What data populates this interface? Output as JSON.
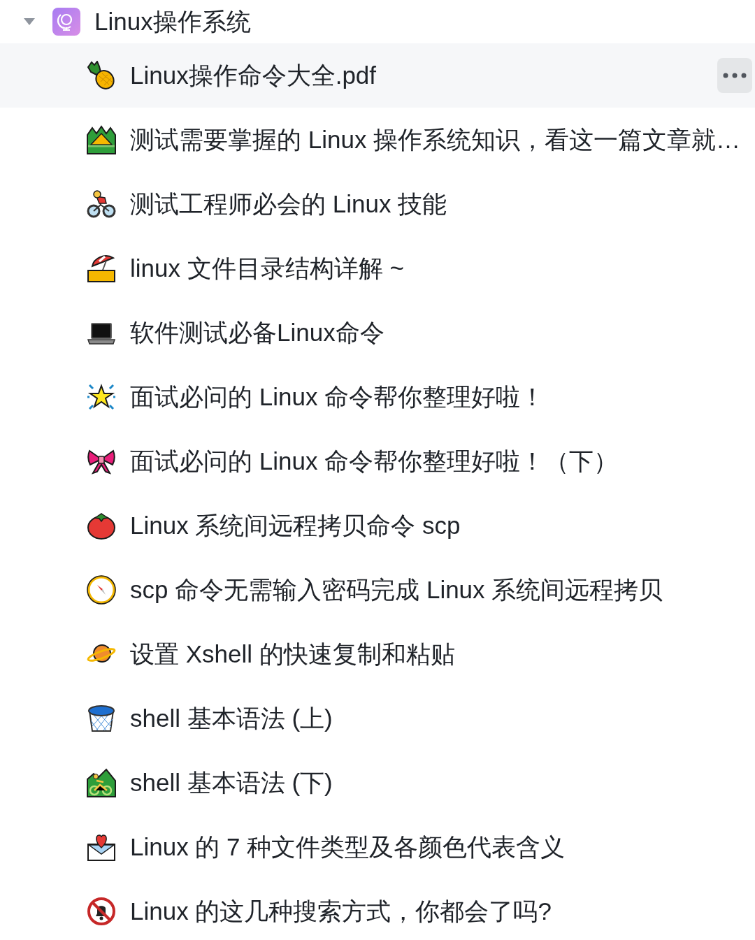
{
  "tree": {
    "label": "Linux操作系统",
    "expanded": true,
    "children": [
      {
        "label": "Linux操作命令大全.pdf",
        "highlighted": true
      },
      {
        "label": "测试需要掌握的 Linux 操作系统知识，看这一篇文章就…",
        "highlighted": false
      },
      {
        "label": "测试工程师必会的 Linux 技能",
        "highlighted": false
      },
      {
        "label": "linux 文件目录结构详解 ~",
        "highlighted": false
      },
      {
        "label": "软件测试必备Linux命令",
        "highlighted": false
      },
      {
        "label": "面试必问的 Linux 命令帮你整理好啦！",
        "highlighted": false
      },
      {
        "label": "面试必问的 Linux 命令帮你整理好啦！（下）",
        "highlighted": false
      },
      {
        "label": "Linux 系统间远程拷贝命令 scp",
        "highlighted": false
      },
      {
        "label": "scp 命令无需输入密码完成 Linux 系统间远程拷贝",
        "highlighted": false
      },
      {
        "label": "设置 Xshell 的快速复制和粘贴",
        "highlighted": false
      },
      {
        "label": "shell 基本语法 (上)",
        "highlighted": false
      },
      {
        "label": "shell 基本语法 (下)",
        "highlighted": false
      },
      {
        "label": "Linux 的 7 种文件类型及各颜色代表含义",
        "highlighted": false
      },
      {
        "label": "Linux 的这几种搜索方式，你都会了吗?",
        "highlighted": false
      }
    ]
  }
}
